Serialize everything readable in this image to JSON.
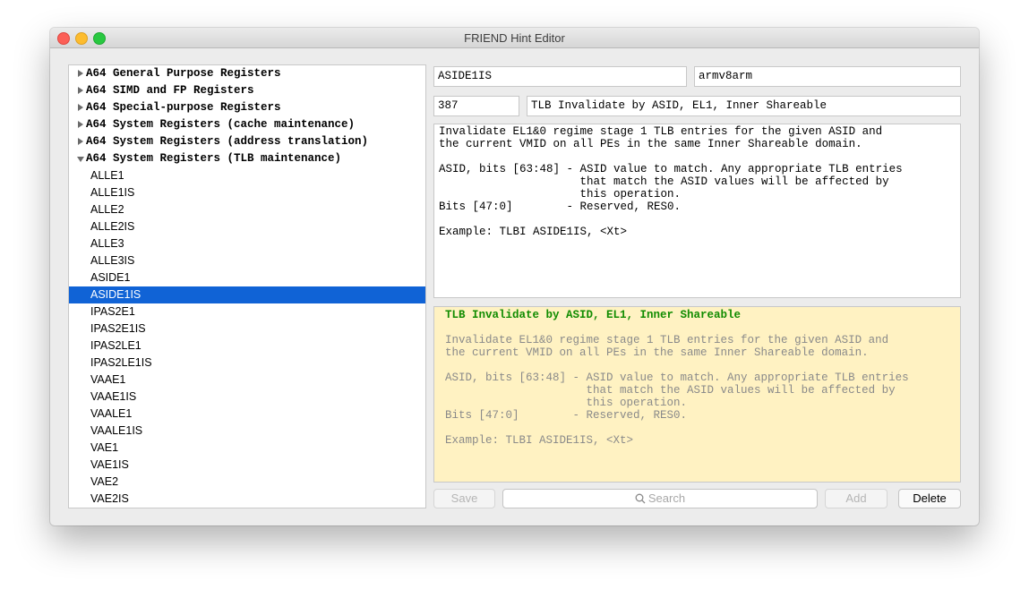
{
  "window": {
    "title": "FRIEND Hint Editor"
  },
  "tree": {
    "groups": [
      {
        "label": "A64 General Purpose Registers",
        "expanded": false
      },
      {
        "label": "A64 SIMD and FP Registers",
        "expanded": false
      },
      {
        "label": "A64 Special-purpose Registers",
        "expanded": false
      },
      {
        "label": "A64 System Registers (cache maintenance)",
        "expanded": false
      },
      {
        "label": "A64 System Registers (address translation)",
        "expanded": false
      },
      {
        "label": "A64 System Registers (TLB maintenance)",
        "expanded": true
      }
    ],
    "items": [
      "ALLE1",
      "ALLE1IS",
      "ALLE2",
      "ALLE2IS",
      "ALLE3",
      "ALLE3IS",
      "ASIDE1",
      "ASIDE1IS",
      "IPAS2E1",
      "IPAS2E1IS",
      "IPAS2LE1",
      "IPAS2LE1IS",
      "VAAE1",
      "VAAE1IS",
      "VAALE1",
      "VAALE1IS",
      "VAE1",
      "VAE1IS",
      "VAE2",
      "VAE2IS"
    ],
    "selected_item": "ASIDE1IS"
  },
  "editor": {
    "name": "ASIDE1IS",
    "arch": "armv8arm",
    "id": "387",
    "summary": "TLB Invalidate by ASID, EL1, Inner Shareable",
    "description": "Invalidate EL1&0 regime stage 1 TLB entries for the given ASID and\nthe current VMID on all PEs in the same Inner Shareable domain.\n\nASID, bits [63:48] - ASID value to match. Any appropriate TLB entries\n                     that match the ASID values will be affected by\n                     this operation.\nBits [47:0]        - Reserved, RES0.\n\nExample: TLBI ASIDE1IS, <Xt>"
  },
  "preview": {
    "title": "TLB Invalidate by ASID, EL1, Inner Shareable",
    "body": "Invalidate EL1&0 regime stage 1 TLB entries for the given ASID and\nthe current VMID on all PEs in the same Inner Shareable domain.\n\nASID, bits [63:48] - ASID value to match. Any appropriate TLB entries\n                     that match the ASID values will be affected by\n                     this operation.\nBits [47:0]        - Reserved, RES0.\n\nExample: TLBI ASIDE1IS, <Xt>"
  },
  "toolbar": {
    "save_label": "Save",
    "search_placeholder": "Search",
    "add_label": "Add",
    "delete_label": "Delete"
  },
  "colors": {
    "selection": "#1063d6",
    "preview_background": "#fff2c2",
    "preview_title": "#118c00"
  }
}
